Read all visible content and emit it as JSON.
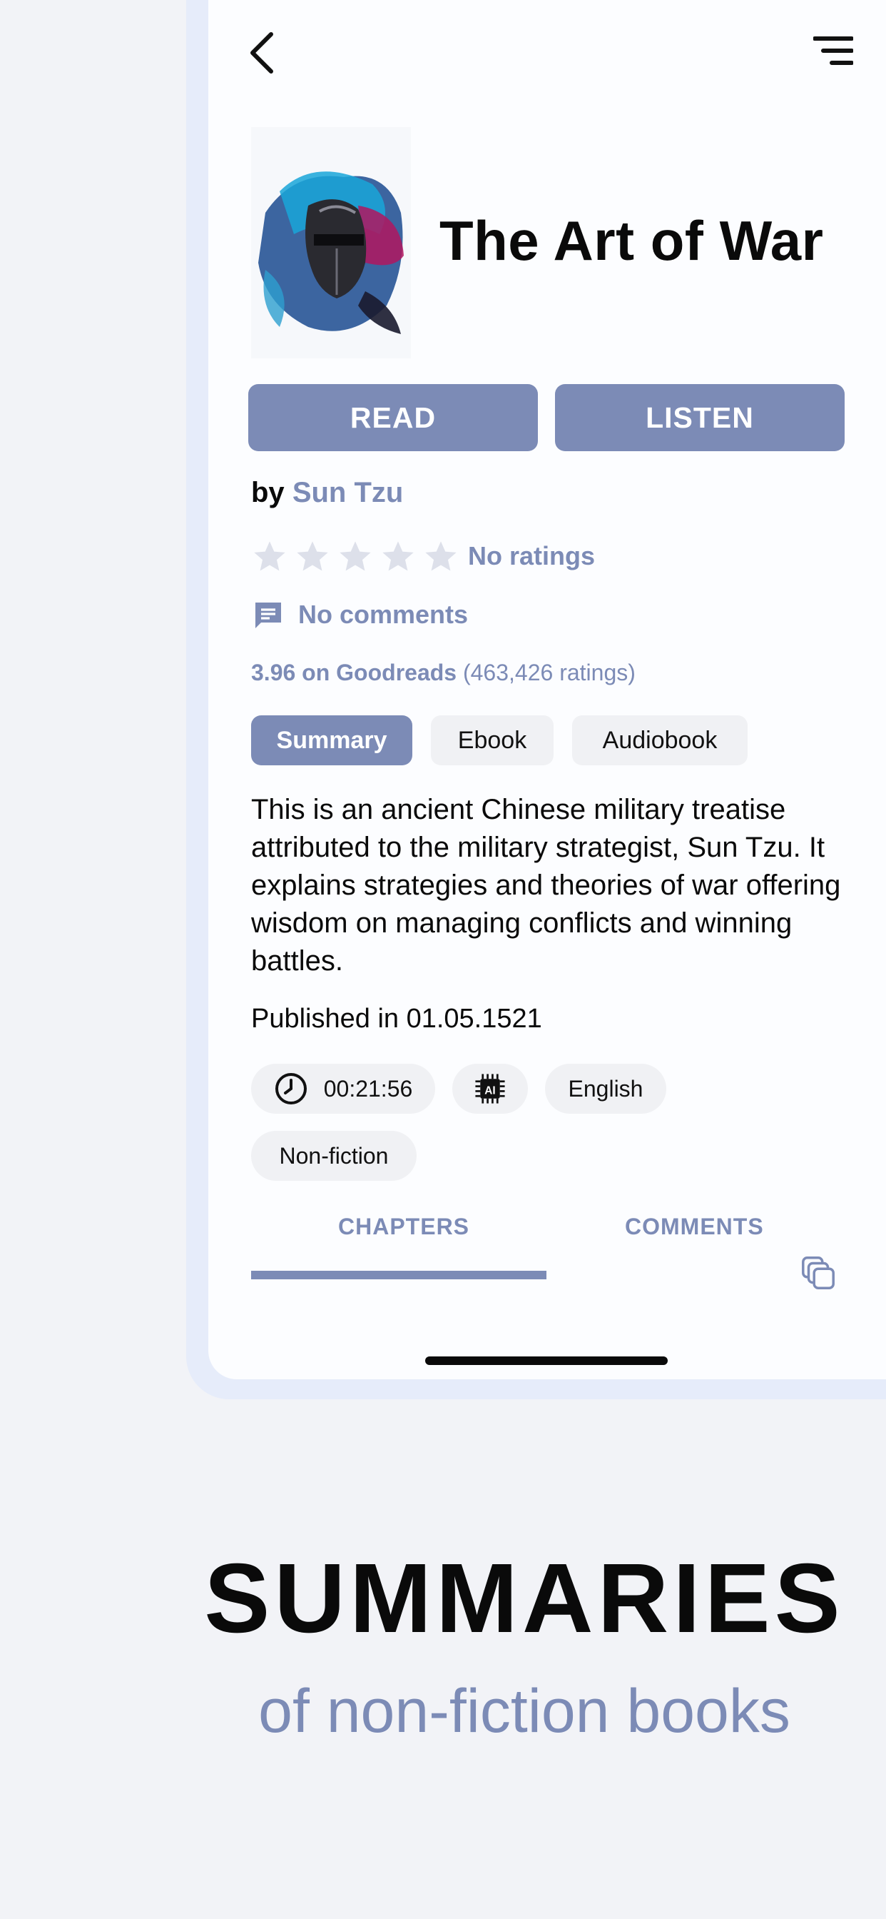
{
  "book": {
    "title": "The Art of War",
    "by_label": "by",
    "author": "Sun Tzu"
  },
  "actions": {
    "read_label": "READ",
    "listen_label": "LISTEN"
  },
  "ratings": {
    "stars_filled": 0,
    "stars_total": 5,
    "label": "No ratings"
  },
  "comments": {
    "label": "No comments"
  },
  "goodreads": {
    "score_text": "3.96 on Goodreads",
    "count_text": "(463,426 ratings)"
  },
  "format_tabs": [
    "Summary",
    "Ebook",
    "Audiobook"
  ],
  "description": "This is an ancient Chinese military treatise attributed to the military strategist, Sun Tzu. It explains strategies and theories of war offering wisdom on managing conflicts and winning battles.",
  "published": "Published in 01.05.1521",
  "meta": {
    "duration": "00:21:56",
    "ai_label": "AI",
    "language": "English",
    "genre": "Non-fiction"
  },
  "section_tabs": {
    "chapters": "CHAPTERS",
    "comments": "COMMENTS"
  },
  "promo": {
    "headline": "SUMMARIES",
    "subline": "of non-fiction books"
  },
  "colors": {
    "accent": "#7c8bb6",
    "background": "#f2f3f7",
    "screen": "#fcfdff",
    "chip": "#f0f1f4"
  },
  "icons": {
    "back": "chevron-left-icon",
    "menu": "menu-lines-icon",
    "star": "star-icon",
    "comment": "comment-icon",
    "clock": "clock-icon",
    "ai": "ai-chip-icon",
    "copy": "copy-icon"
  }
}
